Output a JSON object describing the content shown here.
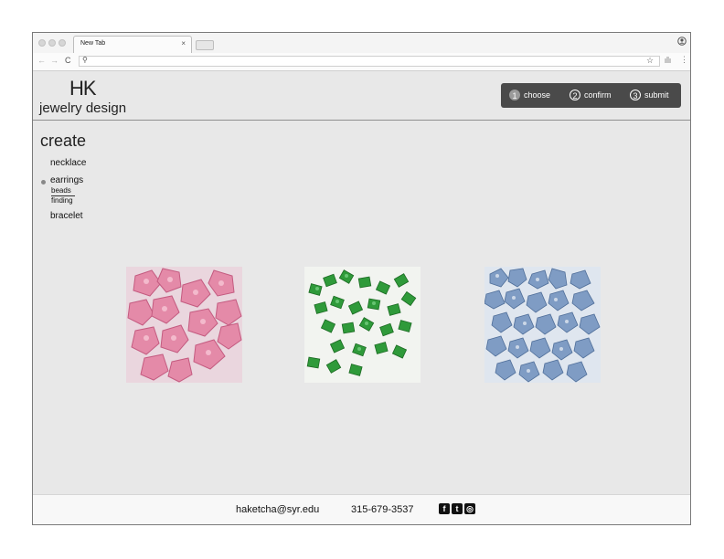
{
  "browser": {
    "tab_title": "New Tab",
    "tab_close": "×",
    "back": "←",
    "forward": "→",
    "reload": "C",
    "search_glyph": "⚲",
    "star": "☆",
    "menu": "⋮",
    "profile_icon": "person-icon"
  },
  "header": {
    "logo_mark": "HK",
    "logo_text": "jewelry design",
    "steps": [
      {
        "num": "1",
        "label": "choose"
      },
      {
        "num": "2",
        "label": "confirm"
      },
      {
        "num": "3",
        "label": "submit"
      }
    ]
  },
  "sidebar": {
    "title": "create",
    "items": [
      {
        "label": "necklace"
      },
      {
        "label": "earrings",
        "sub": [
          "beads",
          "finding"
        ]
      },
      {
        "label": "bracelet"
      }
    ]
  },
  "gallery": [
    {
      "name": "pink-crystal-beads",
      "color": "#e48aa8"
    },
    {
      "name": "green-glass-beads",
      "color": "#2f9a3a"
    },
    {
      "name": "blue-crystal-beads",
      "color": "#7f9cc4"
    }
  ],
  "footer": {
    "email": "haketcha@syr.edu",
    "phone": "315-679-3537",
    "social": [
      {
        "name": "facebook-icon",
        "glyph": "f"
      },
      {
        "name": "twitter-icon",
        "glyph": "t"
      },
      {
        "name": "instagram-icon",
        "glyph": "◎"
      }
    ]
  }
}
